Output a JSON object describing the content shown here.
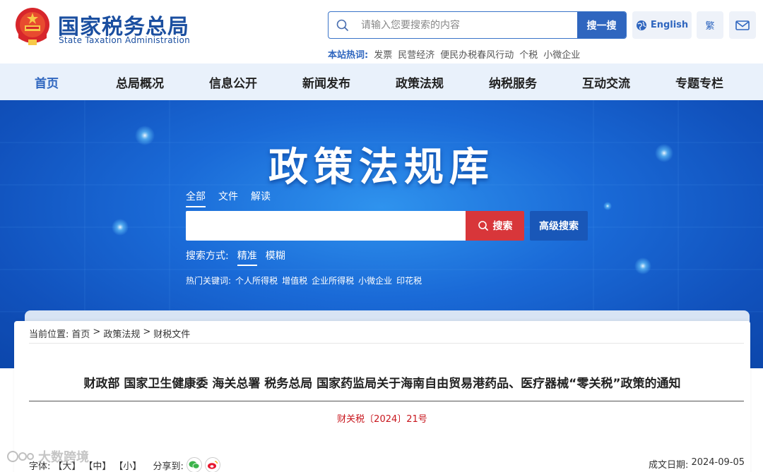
{
  "header": {
    "site_title": "国家税务总局",
    "site_subtitle": "State Taxation Administration",
    "search_placeholder": "请输入您要搜索的内容",
    "search_button": "搜一搜",
    "hot_label": "本站热词:",
    "hot_words": [
      "发票",
      "民营经济",
      "便民办税春风行动",
      "个税",
      "小微企业"
    ],
    "english_label": "English",
    "traditional_label": "繁"
  },
  "nav": {
    "items": [
      "首页",
      "总局概况",
      "信息公开",
      "新闻发布",
      "政策法规",
      "纳税服务",
      "互动交流",
      "专题专栏"
    ],
    "active_index": 0
  },
  "banner": {
    "title": "政策法规库",
    "tabs": [
      "全部",
      "文件",
      "解读"
    ],
    "search_button": "搜索",
    "advanced_search": "高级搜索",
    "mode_label": "搜索方式:",
    "modes": [
      "精准",
      "模糊"
    ],
    "keywords_label": "热门关键词:",
    "keywords": [
      "个人所得税",
      "增值税",
      "企业所得税",
      "小微企业",
      "印花税"
    ]
  },
  "breadcrumb": {
    "label": "当前位置:",
    "items": [
      "首页",
      "政策法规",
      "财税文件"
    ],
    "separator": ">"
  },
  "document": {
    "title": "财政部 国家卫生健康委 海关总署 税务总局 国家药监局关于海南自由贸易港药品、医疗器械“零关税”政策的通知",
    "number": "财关税〔2024〕21号",
    "font_label": "字体:",
    "font_large": "【大】",
    "font_medium": "【中】",
    "font_small": "【小】",
    "share_label": "分享到:",
    "date_label": "成文日期:",
    "date": "2024-09-05"
  },
  "watermark": "大数跨境",
  "colors": {
    "brand_blue": "#2f66bf",
    "nav_bg": "#e9f1fb",
    "search_red": "#d8363a",
    "doc_number_red": "#c8161d"
  }
}
